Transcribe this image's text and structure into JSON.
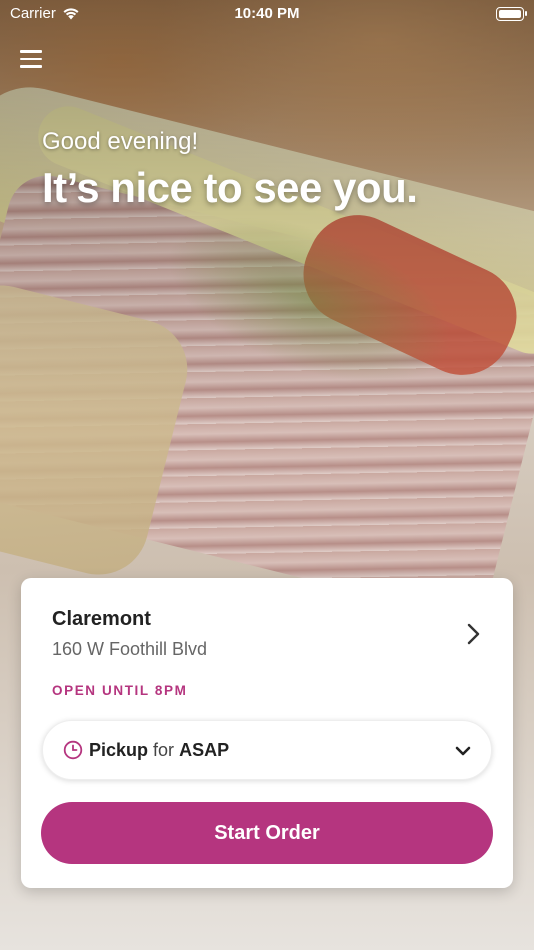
{
  "status_bar": {
    "carrier": "Carrier",
    "time": "10:40 PM",
    "icons": [
      "wifi-icon",
      "battery-icon"
    ]
  },
  "menu": {
    "icon": "hamburger-menu-icon"
  },
  "greeting": {
    "subtitle": "Good evening!",
    "title": "It’s nice to see you."
  },
  "location": {
    "name": "Claremont",
    "address": "160 W Foothill Blvd",
    "status": "OPEN UNTIL 8PM",
    "icon": "chevron-right-icon"
  },
  "order_mode": {
    "icon": "clock-icon",
    "mode": "Pickup",
    "connector": "for",
    "time": "ASAP",
    "dropdown_icon": "chevron-down-icon"
  },
  "start_order": {
    "label": "Start Order"
  },
  "colors": {
    "accent": "#b5357f",
    "card_background": "#ffffff",
    "text_primary": "#222222",
    "text_secondary": "#666666"
  }
}
